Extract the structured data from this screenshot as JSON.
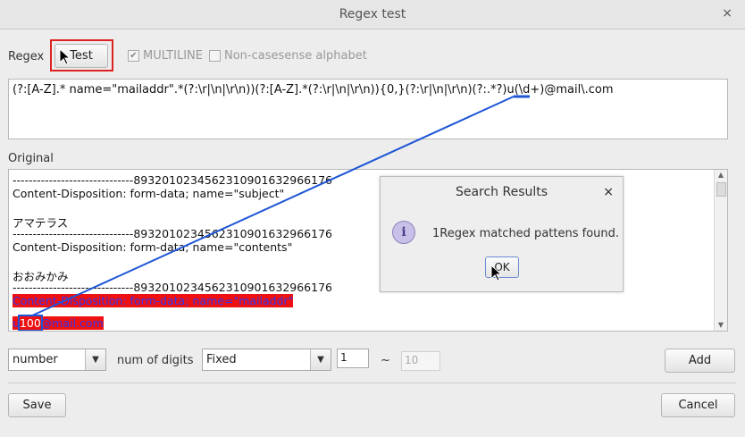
{
  "window": {
    "title": "Regex test",
    "close_glyph": "×"
  },
  "regex": {
    "label": "Regex",
    "test_button": "Test",
    "multiline_label": "MULTILINE",
    "multiline_checked": true,
    "noncase_label": "Non-casesense alphabet",
    "noncase_checked": false,
    "pattern": "(?:[A-Z].* name=\"mailaddr\".*(?:\\r|\\n|\\r\\n))(?:[A-Z].*(?:\\r|\\n|\\r\\n)){0,}(?:\\r|\\n|\\r\\n)(?:.*?)u(\\d+)@mail\\.com"
  },
  "original": {
    "label": "Original",
    "lines": [
      {
        "text": "------------------------------89320102345623109016329661​76",
        "style": "normal"
      },
      {
        "text": "Content-Disposition: form-data; name=\"subject\"",
        "style": "normal"
      },
      {
        "text": "",
        "style": "normal"
      },
      {
        "text": "アマテラス",
        "style": "normal"
      },
      {
        "text": "------------------------------8932010234562310901632966176",
        "style": "normal"
      },
      {
        "text": "Content-Disposition: form-data; name=\"contents\"",
        "style": "normal"
      },
      {
        "text": "",
        "style": "normal"
      },
      {
        "text": "おおみかみ",
        "style": "normal"
      },
      {
        "text": "------------------------------8932010234562310901632966176",
        "style": "normal"
      },
      {
        "text": "Content-Disposition: form-data; name=\"mailaddr\"",
        "style": "red"
      },
      {
        "text": "",
        "style": "normal"
      }
    ],
    "match_prefix": "u",
    "match_group": "100",
    "match_suffix": "@mail.com"
  },
  "dialog": {
    "title": "Search Results",
    "close_glyph": "×",
    "icon": "info-icon",
    "message": "1Regex matched pattens found.",
    "ok_button": "OK"
  },
  "controls": {
    "type_select": "number",
    "digits_label": "num of digits",
    "digits_mode": "Fixed",
    "min_value": "1",
    "range_sep": "~",
    "max_value": "10",
    "add_button": "Add"
  },
  "footer": {
    "save_button": "Save",
    "cancel_button": "Cancel"
  },
  "colors": {
    "highlight": "#ee1111",
    "match_text": "#3333ee",
    "annotation": "#1f56d6"
  }
}
